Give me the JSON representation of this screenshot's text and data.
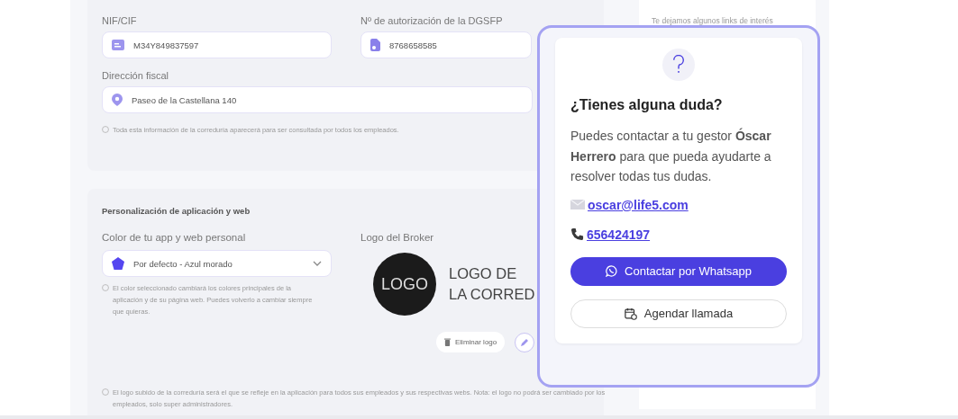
{
  "company_card": {
    "fields": [
      {
        "kind": "id",
        "label": "NIF/CIF",
        "value": "M34Y849837597"
      },
      {
        "kind": "document",
        "label": "Nº de autorización de la DGSFP",
        "value": "8768658585"
      }
    ],
    "address": {
      "label": "Dirección fiscal",
      "value": "Paseo de la Castellana 140"
    },
    "note": "Toda esta información de la correduría aparecerá para ser consultada por todos los empleados."
  },
  "personalization": {
    "title": "Personalización de aplicación y web",
    "color_label": "Color de tu app y web personal",
    "color_select": {
      "value": "Por defecto - Azul morado",
      "color": "#5546f0"
    },
    "color_note": "El color seleccionado cambiará los colores principales de la aplicación y de su página web. Puedes volverlo a cambiar siempre que quieras.",
    "logo_label": "Logo del Broker",
    "logo": {
      "mark": "LOGO",
      "text_lines": [
        "LOGO DE",
        "LA CORRED"
      ]
    },
    "delete_button": "Eliminar logo",
    "note": "El logo subido de la correduría será el que se refleje en la aplicación para todos sus empleados y sus respectivas webs. Nota: el logo no podrá ser cambiado por los empleados, solo super administradores."
  },
  "links_panel": {
    "intro": "Te dejamos algunos links de interés"
  },
  "help_card": {
    "title": "¿Tienes alguna duda?",
    "message": "Puedes contactar a tu gestor **Óscar Herrero** para que pueda ayudarte a resolver todas tus dudas.",
    "email": "oscar@life5.com",
    "phone": "656424197",
    "primary_button": "Contactar por Whatsapp",
    "secondary_button": "Agendar llamada"
  }
}
